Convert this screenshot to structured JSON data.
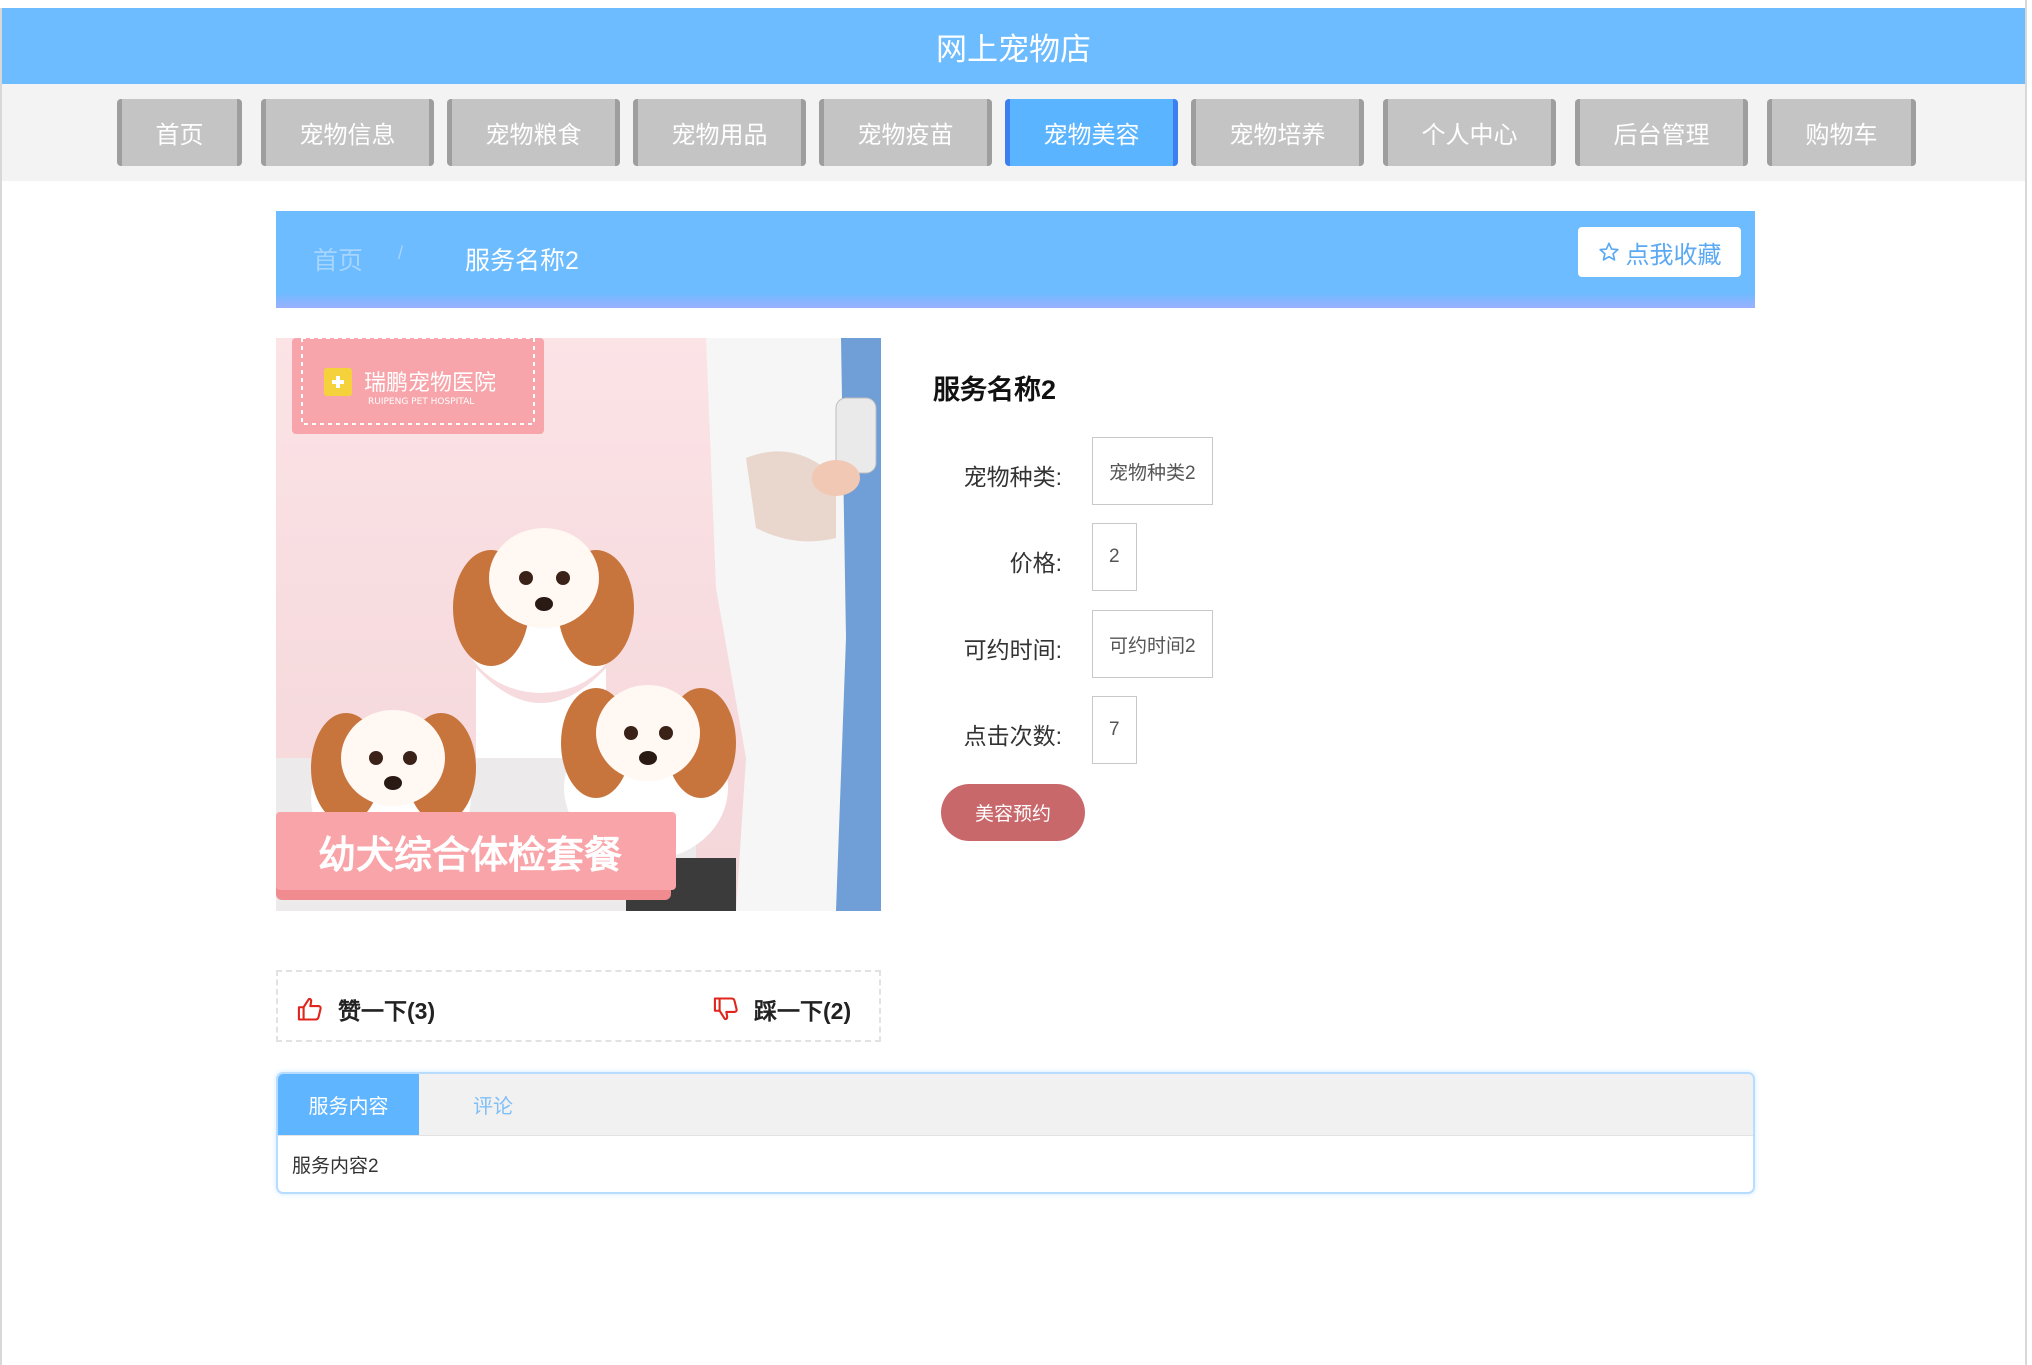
{
  "header": {
    "title": "网上宠物店"
  },
  "nav": {
    "items": [
      {
        "label": "首页"
      },
      {
        "label": "宠物信息"
      },
      {
        "label": "宠物粮食"
      },
      {
        "label": "宠物用品"
      },
      {
        "label": "宠物疫苗"
      },
      {
        "label": "宠物美容"
      },
      {
        "label": "宠物培养"
      },
      {
        "label": "个人中心"
      },
      {
        "label": "后台管理"
      },
      {
        "label": "购物车"
      }
    ],
    "active_label": "宠物美容"
  },
  "breadcrumb": {
    "home": "首页",
    "separator": "/",
    "current": "服务名称2"
  },
  "favorite": {
    "label": "点我收藏",
    "icon": "star-outline-icon"
  },
  "image": {
    "logo_cn": "瑞鹏宠物医院",
    "logo_en": "RUIPENG PET HOSPITAL",
    "banner_text": "幼犬综合体检套餐"
  },
  "product": {
    "title": "服务名称2",
    "fields": [
      {
        "label": "宠物种类:",
        "value": "宠物种类2"
      },
      {
        "label": "价格:",
        "value": "2"
      },
      {
        "label": "可约时间:",
        "value": "可约时间2"
      },
      {
        "label": "点击次数:",
        "value": "7"
      }
    ],
    "book_label": "美容预约"
  },
  "votes": {
    "like_label": "赞一下(3)",
    "dislike_label": "踩一下(2)",
    "like_icon": "thumbs-up-icon",
    "dislike_icon": "thumbs-down-icon"
  },
  "tabs": {
    "items": [
      {
        "label": "服务内容"
      },
      {
        "label": "评论"
      }
    ],
    "active": "服务内容",
    "content": "服务内容2"
  },
  "colors": {
    "primary": "#6cbcff",
    "nav_inactive": "#c4c4c4",
    "nav_active": "#5ab4ff",
    "book_button": "#c9686b",
    "vote_icon": "#e0251c"
  }
}
